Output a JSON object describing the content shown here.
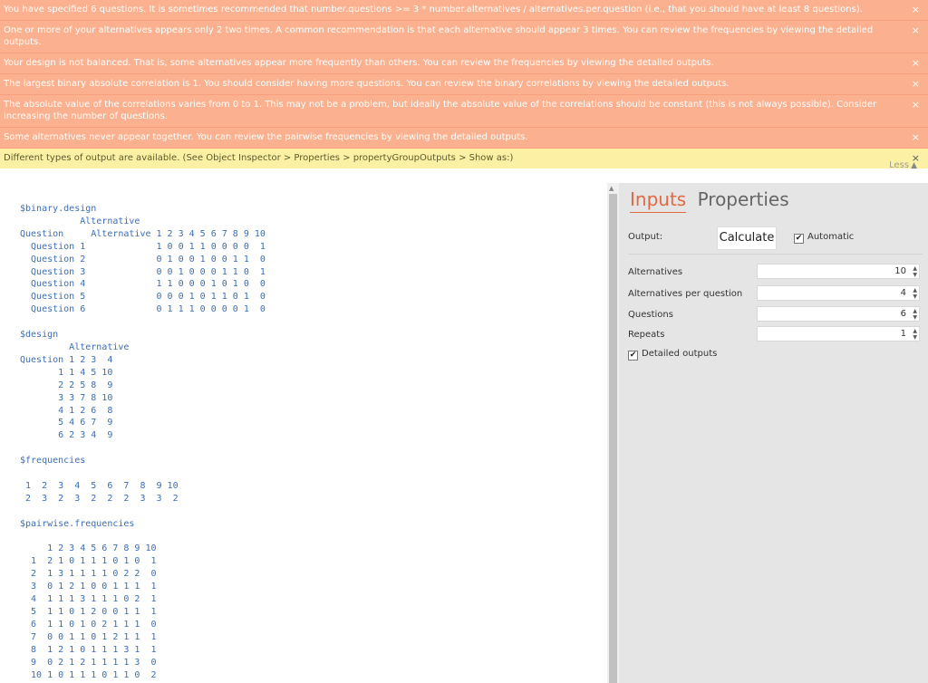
{
  "warnings": [
    "You have specified 6 questions. It is sometimes recommended that number.questions >= 3 * number.alternatives / alternatives.per.question (i.e., that you should have at least 8 questions).",
    "One or more of your alternatives appears only 2 two times. A common recommendation is that each alternative should appear 3 times. You can review the frequencies by viewing the detailed outputs.",
    "Your design is not balanced. That is, some alternatives appear more frequently than others. You can review the frequencies by viewing the detailed outputs.",
    "The largest binary absolute correlation is 1. You should consider having more questions. You can review the binary correlations by viewing the detailed outputs.",
    "The absolute value of the correlations varies from 0 to 1. This may not be a problem, but ideally the absolute value of the correlations should be constant (this is not always possible). Consider increasing the number of questions.",
    "Some alternatives never appear together. You can review the pairwise frequencies by viewing the detailed outputs."
  ],
  "info": "Different types of output are available. (See Object Inspector > Properties > propertyGroupOutputs > Show as:)",
  "close_glyph": "×",
  "less_label": "Less",
  "output_text": "$binary.design\n           Alternative\nQuestion     Alternative 1 2 3 4 5 6 7 8 9 10\n  Question 1             1 0 0 1 1 0 0 0 0  1\n  Question 2             0 1 0 0 1 0 0 1 1  0\n  Question 3             0 0 1 0 0 0 1 1 0  1\n  Question 4             1 1 0 0 0 1 0 1 0  0\n  Question 5             0 0 0 1 0 1 1 0 1  0\n  Question 6             0 1 1 1 0 0 0 0 1  0\n\n$design\n         Alternative\nQuestion 1 2 3  4\n       1 1 4 5 10\n       2 2 5 8  9\n       3 3 7 8 10\n       4 1 2 6  8\n       5 4 6 7  9\n       6 2 3 4  9\n\n$frequencies\n\n 1  2  3  4  5  6  7  8  9 10\n 2  3  2  3  2  2  2  3  3  2\n\n$pairwise.frequencies\n\n     1 2 3 4 5 6 7 8 9 10\n  1  2 1 0 1 1 1 0 1 0  1\n  2  1 3 1 1 1 1 0 2 2  0\n  3  0 1 2 1 0 0 1 1 1  1\n  4  1 1 1 3 1 1 1 0 2  1\n  5  1 1 0 1 2 0 0 1 1  1\n  6  1 1 0 1 0 2 1 1 1  0\n  7  0 0 1 1 0 1 2 1 1  1\n  8  1 2 1 0 1 1 1 3 1  1\n  9  0 2 1 2 1 1 1 1 3  0\n  10 1 0 1 1 1 0 1 1 0  2",
  "panel": {
    "tab_inputs": "Inputs",
    "tab_properties": "Properties",
    "output_label": "Output:",
    "calculate_label": "Calculate",
    "automatic_label": "Automatic",
    "automatic_checked": true,
    "fields": [
      {
        "label": "Alternatives",
        "value": "10"
      },
      {
        "label": "Alternatives per question",
        "value": "4"
      },
      {
        "label": "Questions",
        "value": "6"
      },
      {
        "label": "Repeats",
        "value": "1"
      }
    ],
    "detailed_label": "Detailed outputs",
    "detailed_checked": true
  },
  "colors": {
    "warning_bg": "#fbb18f",
    "info_bg": "#fcf0a4",
    "accent": "#e06a44",
    "output_text": "#3b6eb5"
  }
}
